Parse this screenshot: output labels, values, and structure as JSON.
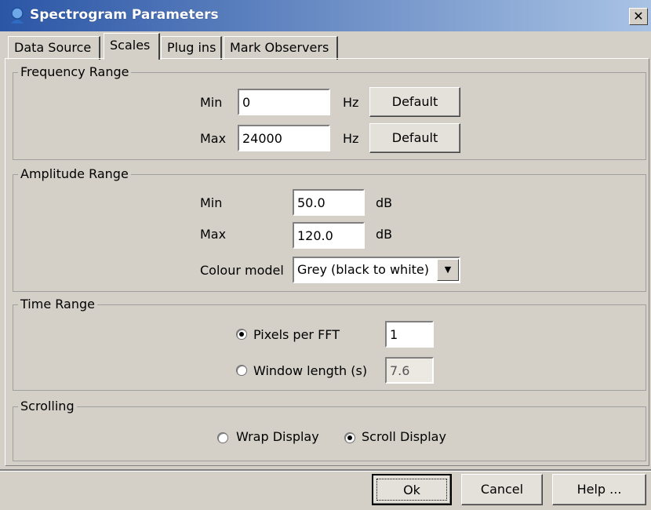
{
  "window": {
    "title": "Spectrogram Parameters",
    "close_glyph": "✕"
  },
  "tabs": [
    {
      "label": "Data Source",
      "active": false
    },
    {
      "label": "Scales",
      "active": true
    },
    {
      "label": "Plug ins",
      "active": false
    },
    {
      "label": "Mark Observers",
      "active": false
    }
  ],
  "frequency_range": {
    "group_label": "Frequency Range",
    "min_label": "Min",
    "min_value": "0",
    "min_unit": "Hz",
    "max_label": "Max",
    "max_value": "24000",
    "max_unit": "Hz",
    "default_label": "Default"
  },
  "amplitude_range": {
    "group_label": "Amplitude Range",
    "min_label": "Min",
    "min_value": "50.0",
    "min_unit": "dB",
    "max_label": "Max",
    "max_value": "120.0",
    "max_unit": "dB",
    "colour_label": "Colour model",
    "colour_value": "Grey (black to white)"
  },
  "time_range": {
    "group_label": "Time Range",
    "pixels_label": "Pixels per FFT",
    "pixels_value": "1",
    "pixels_selected": true,
    "window_label": "Window length (s)",
    "window_value": "7.6",
    "window_selected": false
  },
  "scrolling": {
    "group_label": "Scrolling",
    "wrap_label": "Wrap Display",
    "wrap_selected": false,
    "scroll_label": "Scroll Display",
    "scroll_selected": true
  },
  "footer": {
    "ok_label": "Ok",
    "cancel_label": "Cancel",
    "help_label": "Help ..."
  }
}
